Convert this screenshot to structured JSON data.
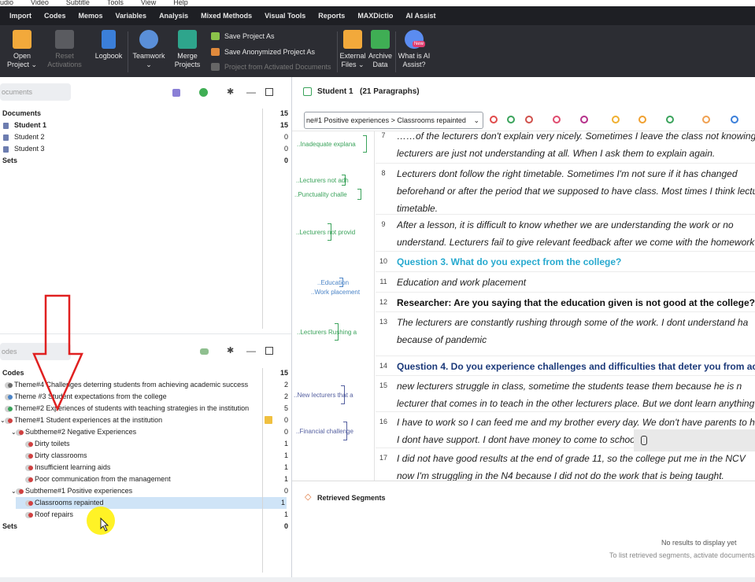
{
  "os_menu": [
    "udio",
    "Video",
    "Subtitle",
    "Tools",
    "View",
    "Help"
  ],
  "main_menu": [
    "Import",
    "Codes",
    "Memos",
    "Variables",
    "Analysis",
    "Mixed Methods",
    "Visual Tools",
    "Reports",
    "MAXDictio",
    "AI Assist"
  ],
  "ribbon": {
    "open_project": "Open\nProject ⌄",
    "reset_activations": "Reset\nActivations",
    "logbook": "Logbook",
    "teamwork": "Teamwork\n⌄",
    "merge_projects": "Merge\nProjects",
    "save_project_as": "Save Project As",
    "save_anonymized": "Save Anonymized Project As",
    "project_from_activated": "Project from Activated Documents",
    "external_files": "External\nFiles ⌄",
    "archive_data": "Archive\nData",
    "what_is_ai": "What is AI\nAssist?",
    "new_badge": "New"
  },
  "documents_panel": {
    "search_placeholder": "ocuments",
    "root": {
      "label": "Documents",
      "count": "15"
    },
    "items": [
      {
        "label": "Student 1",
        "count": "15",
        "selected": true
      },
      {
        "label": "Student 2",
        "count": "0"
      },
      {
        "label": "Student 3",
        "count": "0"
      }
    ],
    "sets": {
      "label": "Sets",
      "count": "0"
    }
  },
  "codes_panel": {
    "search_placeholder": "odes",
    "root": {
      "label": "Codes",
      "count": "15"
    },
    "items": [
      {
        "label": "Theme#4 Challenges deterring students from achieving academic success",
        "count": "2",
        "color": "#6b6b6b"
      },
      {
        "label": "Theme #3 Student expectations from the college",
        "count": "2",
        "color": "#4b84c7"
      },
      {
        "label": "Theme#2 Experiences of students with teaching strategies in the institution",
        "count": "5",
        "color": "#3aa35b"
      },
      {
        "label": "Theme#1 Student experiences at the institution",
        "count": "0",
        "color": "#d04040"
      },
      {
        "label": "Subtheme#2 Negative Experiences",
        "count": "0",
        "color": "#d04040"
      },
      {
        "label": "Dirty toilets",
        "count": "1",
        "color": "#d04040"
      },
      {
        "label": "Dirty classrooms",
        "count": "1",
        "color": "#d04040"
      },
      {
        "label": "Insufficient learning aids",
        "count": "1",
        "color": "#d04040"
      },
      {
        "label": "Poor communication from the management",
        "count": "1",
        "color": "#d04040"
      },
      {
        "label": "Subtheme#1 Positive experiences",
        "count": "0",
        "color": "#d04040"
      },
      {
        "label": "Classrooms repainted",
        "count": "1",
        "color": "#d04040",
        "selected": true
      },
      {
        "label": "Roof repairs",
        "count": "1",
        "color": "#d04040"
      }
    ],
    "sets": {
      "label": "Sets",
      "count": "0"
    }
  },
  "browser": {
    "title": "Student 1",
    "paragraphs_label": "(21 Paragraphs)",
    "code_dropdown": "ne#1 Positive experiences > Classrooms repainted",
    "segments": [
      {
        "label": "..Inadequate explana",
        "color": "green"
      },
      {
        "label": "..Lecturers not adh",
        "color": "green"
      },
      {
        "label": "..Punctuality challe",
        "color": "green"
      },
      {
        "label": "..Lecturers not provid",
        "color": "green"
      },
      {
        "label": "..Education",
        "color": "blue"
      },
      {
        "label": "..Work placement",
        "color": "blue"
      },
      {
        "label": "..Lecturers Rushing a",
        "color": "green"
      },
      {
        "label": "..New lecturers that a",
        "color": "navy"
      },
      {
        "label": "..Financial challenge",
        "color": "navy"
      }
    ],
    "paragraphs": [
      {
        "num": "7",
        "lines": [
          "……of the lecturers don't explain very nicely. Sometimes I leave the class not knowing",
          "lecturers are just not understanding at all. When I ask them to explain again."
        ]
      },
      {
        "num": "8",
        "lines": [
          "Lecturers dont follow the right timetable. Sometimes I'm not sure if it has changed",
          "beforehand or after the period that we supposed to have class. Most times I think lectu",
          "timetable."
        ]
      },
      {
        "num": "9",
        "lines": [
          "After a lesson, it is difficult to know whether we are understanding the work or no",
          "understand. Lecturers fail to give relevant feedback after we come with the homework th"
        ]
      },
      {
        "num": "10",
        "lines": [
          "Question 3. What do you expect from the college?"
        ],
        "style": "q"
      },
      {
        "num": "11",
        "lines": [
          "Education and work placement"
        ]
      },
      {
        "num": "12",
        "lines": [
          "Researcher: Are you saying that the education given is not good at the college?"
        ],
        "style": "rq"
      },
      {
        "num": "13",
        "lines": [
          "The lecturers are constantly rushing through some of the work. I dont understand ha",
          "because of pandemic"
        ]
      },
      {
        "num": "14",
        "lines": [
          "Question 4. Do you experience challenges and difficulties that deter you from ac"
        ],
        "style": "q2"
      },
      {
        "num": "15",
        "lines": [
          "new lecturers struggle in class, sometime the students tease them because he is n",
          "lecturer that comes in to teach in the other lecturers place. But we dont learn anything"
        ]
      },
      {
        "num": "16",
        "lines": [
          "I have to work so I can feed me and my brother every day. We don't have parents to he",
          "I dont have support. I dont have money to come to schoo"
        ]
      },
      {
        "num": "17",
        "lines": [
          "I did not have good results at the end of grade 11, so the college put me in the NCV",
          "now I'm struggling in the N4 because I did not do the work that is being taught."
        ]
      }
    ]
  },
  "retrieved": {
    "title": "Retrieved Segments",
    "empty": "No results to display yet",
    "hint": "To list retrieved segments, activate documents"
  }
}
